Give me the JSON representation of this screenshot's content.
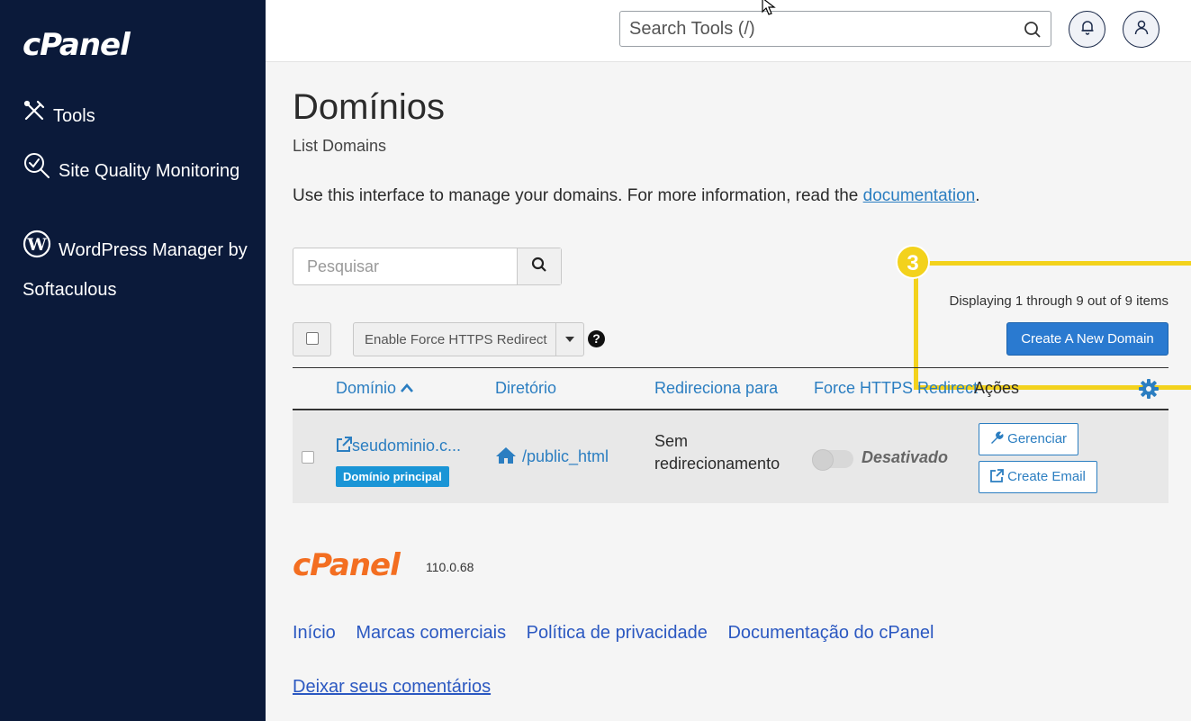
{
  "sidebar": {
    "logo": "cPanel",
    "items": [
      {
        "label": "Tools",
        "icon": "tools-icon"
      },
      {
        "label": "Site Quality Monitoring",
        "icon": "site-quality-icon"
      },
      {
        "label": "WordPress Manager by Softaculous",
        "icon": "wordpress-icon"
      }
    ]
  },
  "header": {
    "search_placeholder": "Search Tools (/)",
    "icons": [
      "search-icon",
      "bell-icon",
      "user-icon"
    ]
  },
  "main": {
    "title": "Domínios",
    "subtitle": "List Domains",
    "intro_text": "Use this interface to manage your domains. For more information, read the ",
    "intro_link": "documentation",
    "intro_end": ".",
    "search_placeholder": "Pesquisar",
    "bulk_action_label": "Enable Force HTTPS Redirect",
    "help_glyph": "?",
    "displaying_text": "Displaying 1 through 9 out of 9 items",
    "create_button": "Create A New Domain",
    "step_number": "3",
    "table": {
      "headers": [
        "Domínio",
        "Diretório",
        "Redireciona para",
        "Force HTTPS Redirect",
        "Ações"
      ],
      "rows": [
        {
          "domain": "seudominio.c...",
          "badge": "Domínio principal",
          "directory": "/public_html",
          "redirect": "Sem redirecionamento",
          "https_status": "Desativado",
          "https_enabled": false,
          "actions": [
            "Gerenciar",
            "Create Email"
          ]
        }
      ]
    }
  },
  "footer": {
    "logo": "cPanel",
    "version": "110.0.68",
    "links": [
      "Início",
      "Marcas comerciais",
      "Política de privacidade",
      "Documentação do cPanel"
    ],
    "feedback": "Deixar seus comentários"
  },
  "colors": {
    "sidebar_bg": "#0b1a3a",
    "link": "#2b7ec1",
    "primary_button": "#2a7ad0",
    "highlight": "#f3d21c",
    "footer_logo": "#f36e21"
  }
}
